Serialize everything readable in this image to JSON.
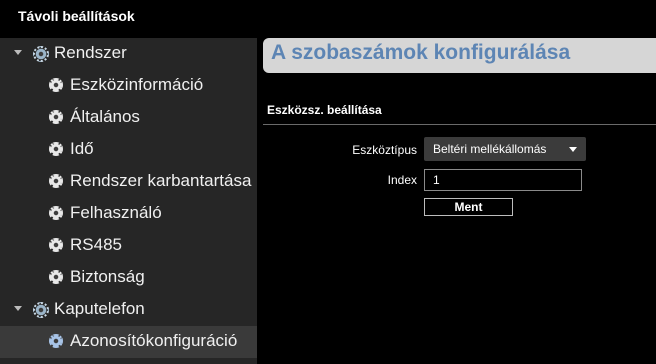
{
  "window": {
    "title": "Távoli beállítások"
  },
  "sidebar": {
    "groups": [
      {
        "label": "Rendszer",
        "items": [
          {
            "label": "Eszközinformáció"
          },
          {
            "label": "Általános"
          },
          {
            "label": "Idő"
          },
          {
            "label": "Rendszer karbantartása"
          },
          {
            "label": "Felhasználó"
          },
          {
            "label": "RS485"
          },
          {
            "label": "Biztonság"
          }
        ]
      },
      {
        "label": "Kaputelefon",
        "items": [
          {
            "label": "Azonosítókonfiguráció",
            "selected": true
          }
        ]
      }
    ]
  },
  "main": {
    "page_title": "A szobaszámok konfigurálása",
    "section_title": "Eszközsz. beállítása",
    "device_type": {
      "label": "Eszköztípus",
      "value": "Beltéri mellékállomás"
    },
    "index": {
      "label": "Index",
      "value": "1"
    },
    "save_label": "Ment"
  },
  "colors": {
    "accent": "#5d85b4",
    "sidebar_bg": "#262626",
    "selected_bg": "#3a3a3a",
    "title_bar_bg": "#d6d6d6"
  }
}
